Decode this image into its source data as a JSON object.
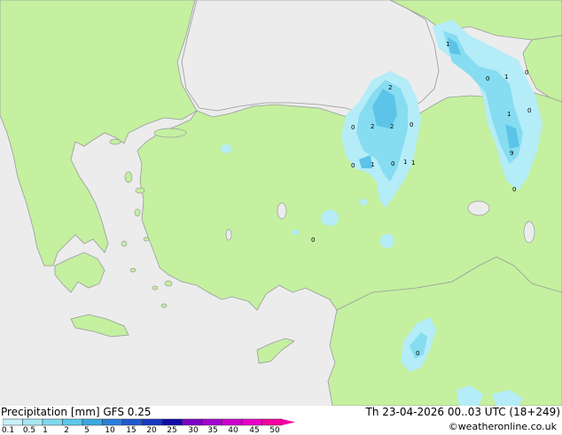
{
  "footer": {
    "title": "Precipitation [mm]  GFS 0.25",
    "valid_time": "Th 23-04-2026 00..03 UTC (18+249)",
    "credit": "©weatheronline.co.uk"
  },
  "legend": {
    "ticks": [
      "0.1",
      "0.5",
      "1",
      "2",
      "5",
      "10",
      "15",
      "20",
      "25",
      "30",
      "35",
      "40",
      "45",
      "50"
    ],
    "colors": [
      "#c8f0f8",
      "#a8e6f4",
      "#80d8ee",
      "#5ec8ea",
      "#3aa8e0",
      "#2a80dc",
      "#2058d0",
      "#1638c0",
      "#100ca8",
      "#7c06c8",
      "#a404d0",
      "#cc00d0",
      "#e800c8",
      "#f400a0"
    ]
  },
  "map": {
    "colors": {
      "sea": "#ececec",
      "land": "#c4f0a0",
      "coast": "#9a9a9a",
      "rain_light": "#b4ecf8",
      "rain_mid": "#86dcf0",
      "rain_heavy": "#5cc4e8"
    },
    "precip_labels": [
      "1",
      "0",
      "1",
      "0",
      "2",
      "1",
      "0",
      "2",
      "2",
      "0",
      "0",
      "1",
      "0",
      "1",
      "0",
      "1",
      "9",
      "0",
      "0",
      "0"
    ]
  }
}
